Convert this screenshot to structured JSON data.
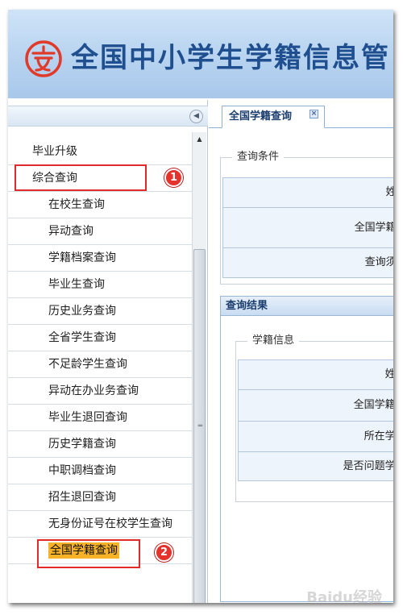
{
  "header": {
    "title": "全国中小学生学籍信息管"
  },
  "nav": {
    "items": [
      {
        "label": "毕业升级",
        "level": 1
      },
      {
        "label": "综合查询",
        "level": 1
      },
      {
        "label": "在校生查询",
        "level": 2
      },
      {
        "label": "异动查询",
        "level": 2
      },
      {
        "label": "学籍档案查询",
        "level": 2
      },
      {
        "label": "毕业生查询",
        "level": 2
      },
      {
        "label": "历史业务查询",
        "level": 2
      },
      {
        "label": "全省学生查询",
        "level": 2
      },
      {
        "label": "不足龄学生查询",
        "level": 2
      },
      {
        "label": "异动在办业务查询",
        "level": 2
      },
      {
        "label": "毕业生退回查询",
        "level": 2
      },
      {
        "label": "历史学籍查询",
        "level": 2
      },
      {
        "label": "中职调档查询",
        "level": 2
      },
      {
        "label": "招生退回查询",
        "level": 2
      },
      {
        "label": "无身份证号在校学生查询",
        "level": 2
      },
      {
        "label": "全国学籍查询",
        "level": 2,
        "selected": true
      }
    ]
  },
  "annotations": {
    "badge_1": "1",
    "badge_2": "2"
  },
  "tab": {
    "label": "全国学籍查询",
    "close_glyph": "×"
  },
  "query_conditions": {
    "legend": "查询条件",
    "fields": [
      "姓名:",
      "全国学籍号:",
      "查询须知:"
    ]
  },
  "query_results": {
    "title": "查询结果",
    "student_info": {
      "legend": "学籍信息",
      "fields": [
        "姓名:",
        "全国学籍号:",
        "所在学段:",
        "是否问题学籍:"
      ]
    }
  },
  "watermark": "Baidu经验",
  "colors": {
    "accent_blue": "#1f4f8f",
    "selection_orange": "#f7b228",
    "highlight_red": "#e12a2a"
  }
}
